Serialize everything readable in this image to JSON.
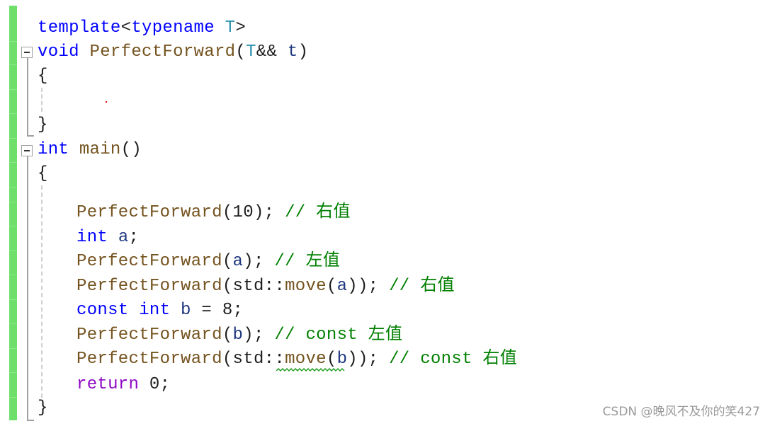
{
  "editor": {
    "lines": {
      "l1": {
        "kw": "template",
        "lt": "<",
        "kw2": "typename",
        "sp": " ",
        "ty": "T",
        "gt": ">"
      },
      "l2": {
        "kw": "void",
        "fn": "PerfectForward",
        "open": "(",
        "ty": "T",
        "amp": "&& ",
        "par": "t",
        "close": ")"
      },
      "l3": {
        "brace": "{"
      },
      "l5": {
        "brace": "}"
      },
      "l6": {
        "kw": "int",
        "fn": "main",
        "rest": "()"
      },
      "l7": {
        "brace": "{"
      },
      "l9": {
        "fn": "PerfectForward",
        "args": "(10); ",
        "cm": "// 右值"
      },
      "l10": {
        "kw": "int",
        "par": "a",
        "rest": ";"
      },
      "l11": {
        "fn": "PerfectForward",
        "open": "(",
        "par": "a",
        "close": "); ",
        "cm": "// 左值"
      },
      "l12": {
        "fn": "PerfectForward",
        "open": "(std::",
        "fn2": "move",
        "open2": "(",
        "par": "a",
        "close": ")); ",
        "cm": "// 右值"
      },
      "l13": {
        "kw": "const",
        "kw2": "int",
        "par": "b",
        "rest": " = 8;"
      },
      "l14": {
        "fn": "PerfectForward",
        "open": "(",
        "par": "b",
        "close": "); ",
        "cm": "// const 左值"
      },
      "l15": {
        "fn": "PerfectForward",
        "open": "(std::",
        "fn2": "move",
        "open2": "(",
        "par": "b",
        "close": ")); ",
        "cm": "// const 右值"
      },
      "l16": {
        "kw": "return",
        "rest": " 0;"
      },
      "l17": {
        "brace": "}"
      }
    }
  },
  "watermark": "CSDN @晚风不及你的笑427"
}
